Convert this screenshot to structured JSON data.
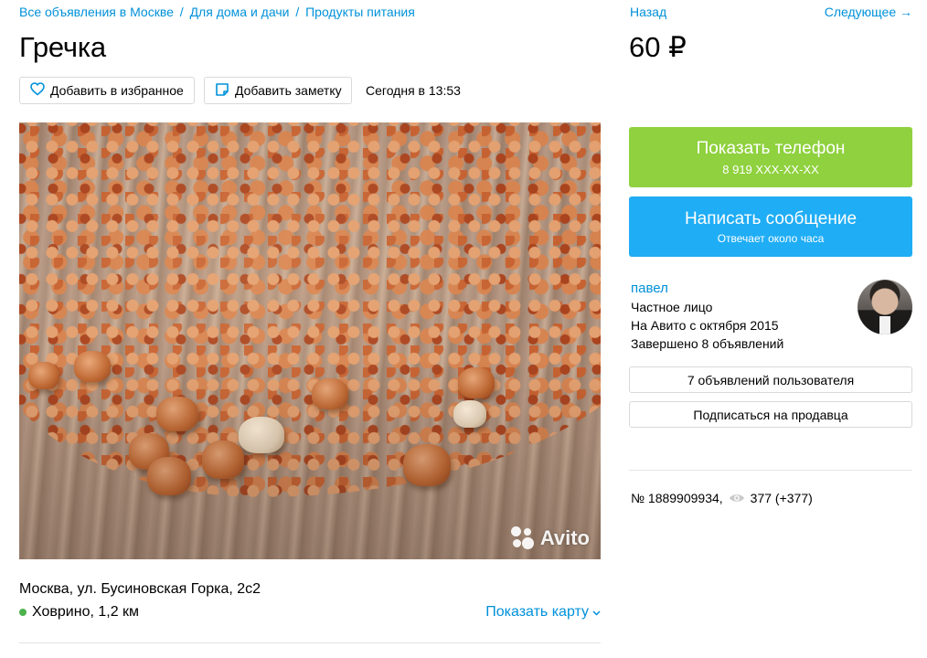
{
  "breadcrumb": {
    "items": [
      "Все объявления в Москве",
      "Для дома и дачи",
      "Продукты питания"
    ],
    "separator": "/"
  },
  "nav": {
    "back": "Назад",
    "next": "Следующее →"
  },
  "listing": {
    "title": "Гречка",
    "price": "60 ₽",
    "favorite_label": "Добавить в избранное",
    "note_label": "Добавить заметку",
    "date": "Сегодня в 13:53",
    "photo": "",
    "watermark": "Avito"
  },
  "location": {
    "address": "Москва, ул. Бусиновская Горка, 2с2",
    "metro": "Ховрино, 1,2 км",
    "metro_color": "#4db34d",
    "map_link": "Показать карту"
  },
  "contact": {
    "phone_label": "Показать телефон",
    "phone_masked": "8 919 XXX-XX-XX",
    "phone_color": "#8fd13e",
    "message_label": "Написать сообщение",
    "message_sub": "Отвечает около часа",
    "message_color": "#1fadf5"
  },
  "seller": {
    "name": "павел",
    "type": "Частное лицо",
    "since": "На Авито с октября 2015",
    "completed": "Завершено 8 объявлений",
    "avatar": "",
    "listings_button": "7 объявлений пользователя",
    "subscribe_button": "Подписаться на продавца"
  },
  "stats": {
    "number": "№ 1889909934,",
    "views": "377 (+377)"
  },
  "colors": {
    "link": "#0091d9"
  },
  "icons": {
    "favorite": "heart-icon",
    "note": "note-icon",
    "views": "eye-icon",
    "map_chevron": "chevron-down-icon"
  }
}
